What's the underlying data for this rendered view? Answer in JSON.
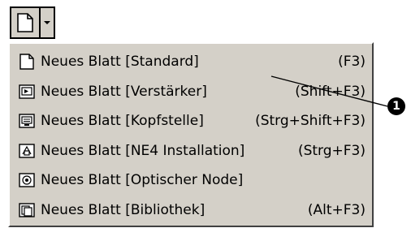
{
  "menu": {
    "items": [
      {
        "label": "Neues Blatt [Standard]",
        "shortcut": "(F3)",
        "icon": "blank-sheet-icon"
      },
      {
        "label": "Neues Blatt [Verstärker]",
        "shortcut": "(Shift+F3)",
        "icon": "amplifier-sheet-icon"
      },
      {
        "label": "Neues Blatt [Kopfstelle]",
        "shortcut": "(Strg+Shift+F3)",
        "icon": "headend-sheet-icon"
      },
      {
        "label": "Neues Blatt [NE4 Installation]",
        "shortcut": "(Strg+F3)",
        "icon": "ne4-installation-sheet-icon"
      },
      {
        "label": "Neues Blatt [Optischer Node]",
        "shortcut": "",
        "icon": "optical-node-sheet-icon"
      },
      {
        "label": "Neues Blatt [Bibliothek]",
        "shortcut": "(Alt+F3)",
        "icon": "library-sheet-icon"
      }
    ]
  },
  "callout": {
    "label": "1"
  },
  "colors": {
    "menu_background": "#d4d0c8",
    "text": "#000000",
    "callout_badge": "#000000"
  }
}
